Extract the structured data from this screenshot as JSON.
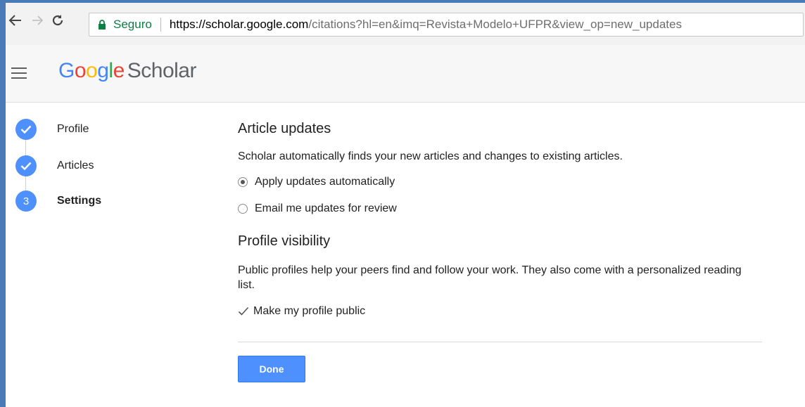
{
  "browser": {
    "secure_label": "Seguro",
    "url_host": "https://scholar.google.com",
    "url_rest": "/citations?hl=en&imq=Revista+Modelo+UFPR&view_op=new_updates"
  },
  "header": {
    "logo_g1": "G",
    "logo_o1": "o",
    "logo_o2": "o",
    "logo_g2": "g",
    "logo_l": "l",
    "logo_e": "e",
    "logo_product": "Scholar"
  },
  "steps": [
    {
      "label": "Profile",
      "state": "done"
    },
    {
      "label": "Articles",
      "state": "done"
    },
    {
      "label": "Settings",
      "state": "current",
      "number": "3"
    }
  ],
  "article_updates": {
    "title": "Article updates",
    "description": "Scholar automatically finds your new articles and changes to existing articles.",
    "options": [
      {
        "label": "Apply updates automatically",
        "selected": true
      },
      {
        "label": "Email me updates for review",
        "selected": false
      }
    ]
  },
  "profile_visibility": {
    "title": "Profile visibility",
    "description": "Public profiles help your peers find and follow your work. They also come with a personalized reading list.",
    "checkbox_label": "Make my profile public",
    "checked": true
  },
  "actions": {
    "done_label": "Done"
  },
  "colors": {
    "accent": "#4d90fe",
    "secure": "#0b8043"
  }
}
